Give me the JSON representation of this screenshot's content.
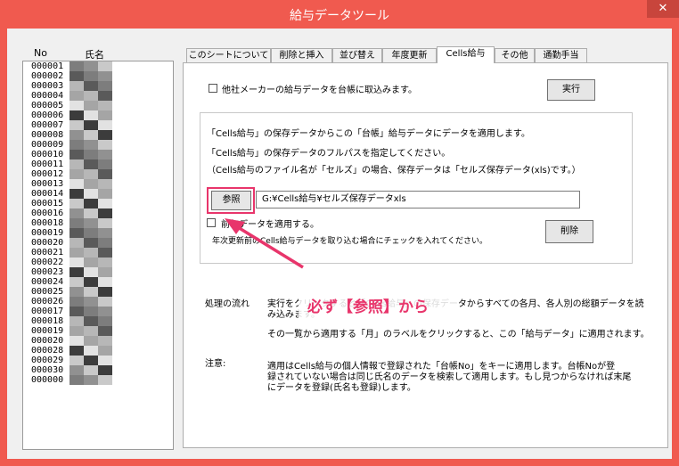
{
  "window": {
    "title": "給与データツール",
    "close_glyph": "✕"
  },
  "list": {
    "header_no": "No",
    "header_name": "氏名",
    "rows": [
      "000001",
      "000002",
      "000003",
      "000004",
      "000005",
      "000006",
      "000007",
      "000008",
      "000009",
      "000010",
      "000011",
      "000012",
      "000013",
      "000014",
      "000015",
      "000016",
      "000018",
      "000019",
      "000020",
      "000021",
      "000022",
      "000023",
      "000024",
      "000025",
      "000026",
      "000017",
      "000018",
      "000019",
      "000020",
      "000028",
      "000029",
      "000030",
      "000000"
    ]
  },
  "tabs": [
    "このシートについて",
    "削除と挿入",
    "並び替え",
    "年度更新",
    "Cells給与",
    "その他",
    "通勤手当"
  ],
  "active_tab": "Cells給与",
  "panel": {
    "import_other_label": "他社メーカーの給与データを台帳に取込みます。",
    "run_button": "実行",
    "desc1": "「Cells給与」の保存データからこの「台帳」給与データにデータを適用します。",
    "desc2": "「Cells給与」の保存データのフルパスを指定してください。",
    "desc3": "（Cells給与のファイル名が「セルズ」の場合、保存データは「セルズ保存データ(xls)です。）",
    "browse_button": "参照",
    "path_value": "G:¥Cells給与¥セルズ保存データxls",
    "prev_year_label": "前年データを適用する。",
    "prev_year_note": "年次更新前のCells給与データを取り込む場合にチェックを入れてください。",
    "delete_button": "削除",
    "flow_label": "処理の流れ",
    "flow_text1": "実行をクリックすると「Cells給与」の保存データからすべての各月、各人別の総額データを読",
    "flow_text1b": "み込みます。",
    "flow_text2": "その一覧から適用する「月」のラベルをクリックすると、この「給与データ」に適用されます。",
    "note_label": "注意:",
    "note_text1": "適用はCells給与の個人情報で登録された「台帳No」をキーに適用します。台帳Noが登",
    "note_text2": "録されていない場合は同じ氏名のデータを検索して適用します。もし見つからなければ末尾",
    "note_text3": "にデータを登録(氏名も登録)します。"
  },
  "annotation": {
    "callout_text": "必ず【参照】から",
    "color": "#e8356b"
  },
  "colors": {
    "titlebar": "#f05a4f",
    "accent": "#e8356b"
  }
}
